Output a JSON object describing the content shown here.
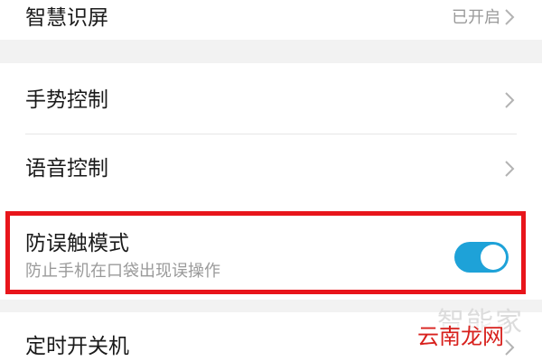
{
  "settings": {
    "smart_screen": {
      "title": "智慧识屏",
      "status": "已开启"
    },
    "gesture_control": {
      "title": "手势控制"
    },
    "voice_control": {
      "title": "语音控制"
    },
    "accidental_touch": {
      "title": "防误触模式",
      "subtitle": "防止手机在口袋出现误操作",
      "enabled": true
    },
    "scheduled_power": {
      "title": "定时开关机"
    }
  },
  "watermark": {
    "top": "智能家",
    "bottom": "云南龙网"
  },
  "colors": {
    "accent": "#1ea2d8",
    "highlight_border": "#e8151b",
    "section_gap": "#f2f2f2"
  },
  "icons": {
    "chevron": "chevron-right-icon"
  }
}
